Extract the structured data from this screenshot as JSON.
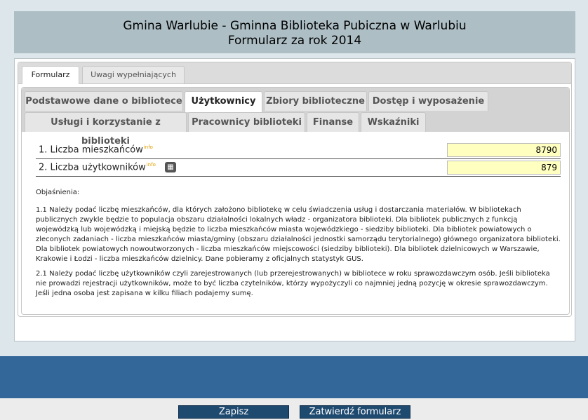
{
  "header": {
    "title_line1": "Gmina Warlubie - Gminna Biblioteka Pubiczna w Warlubiu",
    "title_line2": "Formularz za rok 2014"
  },
  "outer_tabs": [
    {
      "label": "Formularz",
      "active": true
    },
    {
      "label": "Uwagi wypełniających",
      "active": false
    }
  ],
  "inner_tabs": [
    {
      "label": "Podstawowe dane o bibliotece",
      "active": false
    },
    {
      "label": "Użytkownicy",
      "active": true
    },
    {
      "label": "Zbiory biblioteczne",
      "active": false
    },
    {
      "label": "Dostęp i wyposażenie",
      "active": false
    },
    {
      "label": "Usługi i korzystanie z biblioteki",
      "active": false
    },
    {
      "label": "Pracownicy biblioteki",
      "active": false
    },
    {
      "label": "Finanse",
      "active": false
    },
    {
      "label": "Wskaźniki",
      "active": false
    }
  ],
  "fields": [
    {
      "label": "1. Liczba mieszkańców",
      "info": "info",
      "value": "8790"
    },
    {
      "label": "2. Liczba użytkowników",
      "info": "info",
      "value": "879",
      "icon": "calculator-icon"
    }
  ],
  "notes": {
    "heading": "Objaśnienia:",
    "p1": "1.1 Należy podać liczbę mieszkańców, dla których założono bibliotekę w celu świadczenia usług i dostarczania materiałów. W bibliotekach publicznych zwykle będzie to populacja obszaru działalności lokalnych władz - organizatora biblioteki. Dla bibliotek publicznych z funkcją wojewódzką lub wojewódzką i miejską będzie to liczba mieszkańców miasta wojewódzkiego - siedziby biblioteki. Dla bibliotek powiatowych o zleconych zadaniach - liczba mieszkańców miasta/gminy (obszaru działalności jednostki samorządu terytorialnego) głównego organizatora biblioteki. Dla bibliotek powiatowych nowoutworzonych - liczba mieszkańców miejscowości (siedziby biblioteki). Dla bibliotek dzielnicowych w Warszawie, Krakowie i Łodzi - liczba mieszkańców dzielnicy. Dane pobieramy z oficjalnych statystyk GUS.",
    "p2": "2.1 Należy podać liczbę użytkowników czyli zarejestrowanych (lub przerejestrowanych) w bibliotece w roku sprawozdawczym osób. Jeśli biblioteka nie prowadzi rejestracji użytkowników, może to być liczba czytelników, którzy wypożyczyli co najmniej jedną pozycję w okresie sprawozdawczym. Jeśli jedna osoba jest zapisana w kilku filiach podajemy sumę."
  },
  "buttons": {
    "save": "Zapisz",
    "approve": "Zatwierdź formularz"
  },
  "colors": {
    "header_bg": "#adbec5",
    "footer_blue": "#336699",
    "input_bg": "#ffffc0",
    "button_bg": "#1f4a70"
  }
}
